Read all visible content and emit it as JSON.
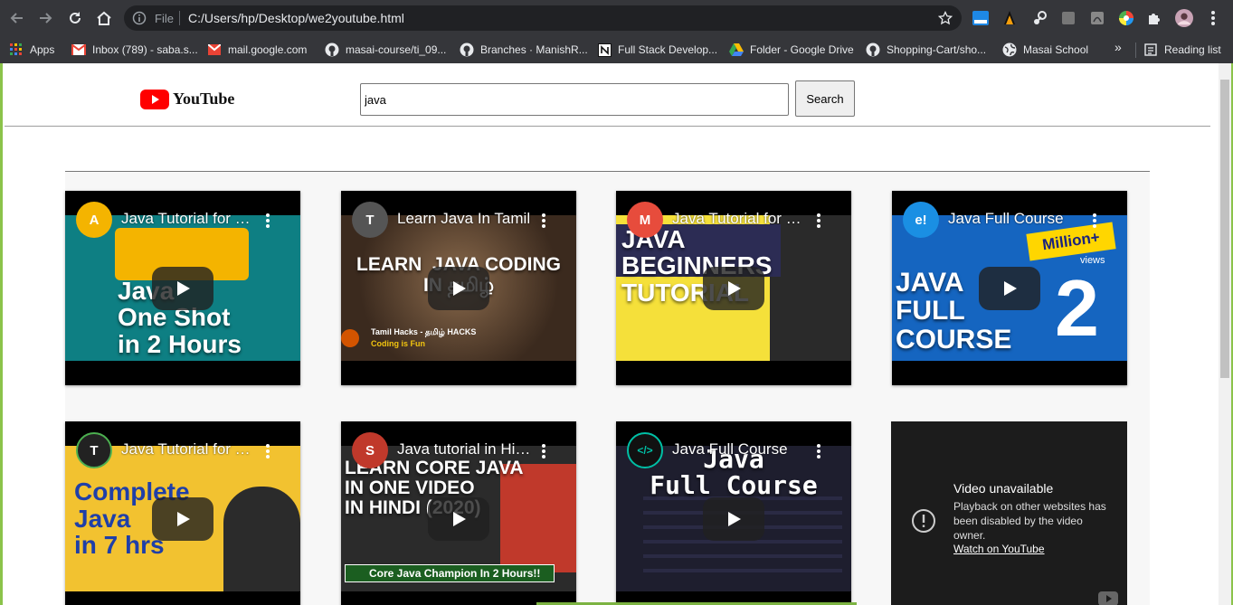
{
  "browser": {
    "omnibox": {
      "scheme": "File",
      "url": "C:/Users/hp/Desktop/we2youtube.html"
    },
    "bookmarks": [
      {
        "label": "Apps",
        "icon": "apps-grid-icon"
      },
      {
        "label": "Inbox (789) - saba.s...",
        "icon": "gmail-icon"
      },
      {
        "label": "mail.google.com",
        "icon": "mail-icon"
      },
      {
        "label": "masai-course/ti_09...",
        "icon": "github-icon"
      },
      {
        "label": "Branches · ManishR...",
        "icon": "github-icon"
      },
      {
        "label": "Full Stack Develop...",
        "icon": "notion-icon"
      },
      {
        "label": "Folder - Google Drive",
        "icon": "google-drive-icon"
      },
      {
        "label": "Shopping-Cart/sho...",
        "icon": "github-icon"
      },
      {
        "label": "Masai School",
        "icon": "globe-icon"
      }
    ],
    "bookmarks_more": "»",
    "reading_list": "Reading list"
  },
  "page": {
    "logo_text": "YouTube",
    "search": {
      "value": "java",
      "button_label": "Search"
    },
    "videos": [
      {
        "title": "Java Tutorial for Beginners",
        "thumb_text": "Java\nOne Shot\nin 2 Hours",
        "channel_initial": "A",
        "brand": "#f4b400",
        "thumb_bg": "#0e7f83"
      },
      {
        "title": "Learn Java In Tamil",
        "thumb_text": "LEARN  JAVA CODING\nIN தமிழ்",
        "channel_initial": "T",
        "brand": "#555555",
        "thumb_bg": "#4e3b2b",
        "caption": "Tamil Hacks - தமிழ் HACKS",
        "caption2": "Coding is Fun"
      },
      {
        "title": "Java Tutorial for Beginners",
        "thumb_text": "JAVA\nBEGINNERS\nTUTORIAL",
        "channel_initial": "M",
        "brand": "#e74c3c",
        "thumb_bg": "#f5e03a"
      },
      {
        "title": "Java Full Course",
        "thumb_text": "JAVA\nFULL\nCOURSE",
        "channel_initial": "e!",
        "brand": "#1a8fe3",
        "thumb_bg": "#1565c0",
        "badge": "Million+",
        "badge2": "views",
        "big_number": "2"
      },
      {
        "title": "Java Tutorial for Beginners",
        "thumb_text": "Complete\nJava\nin 7 hrs",
        "channel_initial": "T",
        "brand": "#222222",
        "thumb_bg": "#f2c230"
      },
      {
        "title": "Java tutorial in Hindi",
        "thumb_text": "LEARN CORE JAVA\nIN ONE VIDEO\nIN HINDI (2020)",
        "channel_initial": "S",
        "brand": "#c0392b",
        "thumb_bg": "#2b2b2b",
        "caption": "Core Java Champion In 2 Hours!!"
      },
      {
        "title": "Java Full Course",
        "thumb_text": "Java\nFull Course",
        "channel_initial": "</>",
        "brand": "#00bfa5",
        "thumb_bg": "#1e1e2e"
      }
    ],
    "unavailable": {
      "title": "Video unavailable",
      "message": "Playback on other websites has been disabled by the video owner.",
      "link": "Watch on YouTube"
    }
  }
}
